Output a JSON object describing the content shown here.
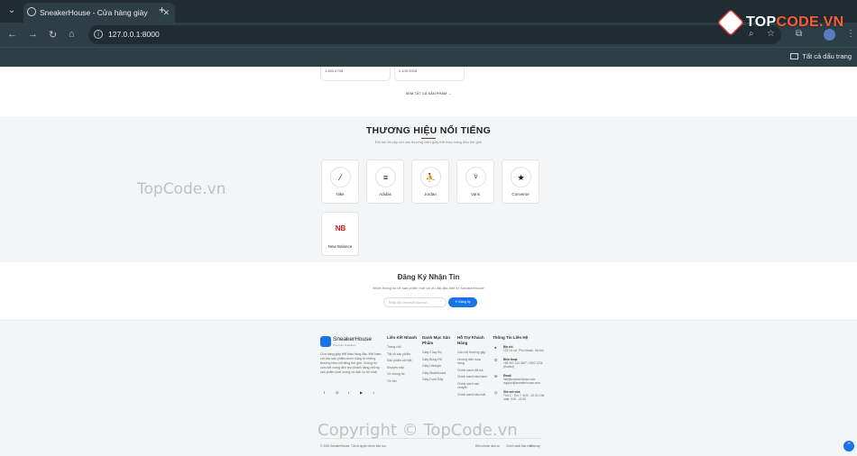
{
  "browser": {
    "tab_title": "SneakerHouse - Cửa hàng giày",
    "url": "127.0.0.1:8000",
    "bookmarks_label": "Tất cả dấu trang"
  },
  "watermark": {
    "brand_left": "TOP",
    "brand_right": "CODE.VN",
    "side": "TopCode.vn",
    "bottom": "Copyright © TopCode.vn"
  },
  "products": [
    {
      "price": "1,650,670đ"
    },
    {
      "price": "2,100,000đ"
    }
  ],
  "view_all": "XEM TẤT CẢ SẢN PHẨM →",
  "brands": {
    "title": "THƯƠNG HIỆU NỔI TIẾNG",
    "subtitle": "Đối tác tin cậy với các thương hiệu giày thể thao hàng đầu thế giới",
    "items": [
      {
        "name": "Nike",
        "icon": "nike-icon",
        "glyph": "⁄"
      },
      {
        "name": "Adidas",
        "icon": "adidas-icon",
        "glyph": "≡"
      },
      {
        "name": "Jordan",
        "icon": "jordan-icon",
        "glyph": "⛹"
      },
      {
        "name": "Vans",
        "icon": "vans-icon",
        "glyph": "V"
      },
      {
        "name": "Converse",
        "icon": "converse-icon",
        "glyph": "★"
      },
      {
        "name": "New Balance",
        "icon": "new-balance-icon",
        "glyph": "NB"
      }
    ]
  },
  "newsletter": {
    "title": "Đăng Ký Nhận Tin",
    "subtitle": "Nhận thông tin về sản phẩm mới và ưu đãi đặc biệt từ SneakerHouse",
    "placeholder": "Nhập địa chỉ email của bạn...",
    "button": "✈ Đăng ký"
  },
  "footer": {
    "brand": "SneakerHouse",
    "tagline": "Premium Sneakers",
    "about": "Cửa hàng giày thể thao hàng đầu Việt Nam với các sản phẩm chính hãng từ những thương hiệu nổi tiếng thế giới. Chúng tôi cam kết mang đến cho khách hàng những sản phẩm chất lượng và dịch vụ tốt nhất.",
    "social": [
      "f",
      "◎",
      "t",
      "▶",
      "♪"
    ],
    "columns": [
      {
        "title": "Liên Kết Nhanh",
        "items": [
          "Trang chủ",
          "Tất cả sản phẩm",
          "Sản phẩm nổi bật",
          "Khuyến mãi",
          "Về chúng tôi",
          "Tin tức"
        ]
      },
      {
        "title": "Danh Mục Sản Phẩm",
        "items": [
          "Giày Chạy Bộ",
          "Giày Bóng Rổ",
          "Giày Lifestyle",
          "Giày Skateboard",
          "Giày Dưới Đây"
        ]
      },
      {
        "title": "Hỗ Trợ Khách Hàng",
        "items": [
          "Câu hỏi thường gặp",
          "Hướng dẫn mua hàng",
          "Chính sách đổi trả",
          "Chính sách bảo hành",
          "Chính sách vận chuyển",
          "Chính sách bảo mật"
        ]
      }
    ],
    "contact": {
      "title": "Thông Tin Liên Hệ",
      "rows": [
        {
          "icon": "●",
          "label": "Địa chỉ",
          "value": "123 Lê Lợi, Phú Nhuận, Hà Nội"
        },
        {
          "icon": "✆",
          "label": "Điện thoại",
          "value": "+84 567 123 4567 / 1900 1234 (Hotline)"
        },
        {
          "icon": "✉",
          "label": "Email",
          "value": "info@sneakerhouse.com support@sneakerhouse.com"
        },
        {
          "icon": "◷",
          "label": "Giờ mở cửa",
          "value": "Thứ 2 - Thứ 7: 8:00 - 22:00 Chủ nhật: 9:00 - 21:00"
        }
      ]
    },
    "copyright": "© 2024 SneakerHouse. Tất cả quyền được bảo lưu.",
    "legal": [
      "Điều khoản dịch vụ",
      "Chính sách bảo mật",
      "Sitemap"
    ]
  }
}
